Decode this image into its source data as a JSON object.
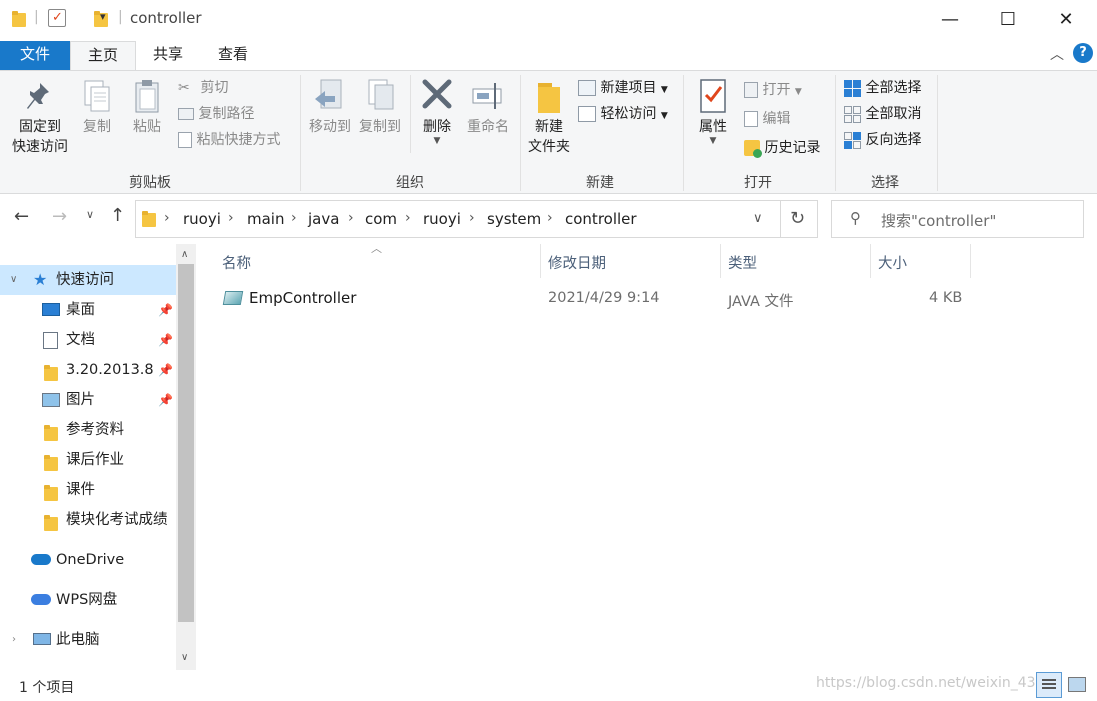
{
  "window": {
    "title": "controller",
    "controls": {
      "minimize": "—",
      "maximize": "☐",
      "close": "✕"
    }
  },
  "tabs": {
    "file": "文件",
    "home": "主页",
    "share": "共享",
    "view": "查看"
  },
  "ribbon": {
    "clipboard": {
      "label": "剪贴板",
      "pin_line1": "固定到",
      "pin_line2": "快速访问",
      "copy": "复制",
      "paste": "粘贴",
      "cut": "剪切",
      "copy_path": "复制路径",
      "paste_shortcut": "粘贴快捷方式"
    },
    "organize": {
      "label": "组织",
      "move_to": "移动到",
      "copy_to": "复制到",
      "delete": "删除",
      "rename": "重命名"
    },
    "new": {
      "label": "新建",
      "new_folder_line1": "新建",
      "new_folder_line2": "文件夹",
      "new_item": "新建项目",
      "easy_access": "轻松访问"
    },
    "open": {
      "label": "打开",
      "properties": "属性",
      "open": "打开",
      "edit": "编辑",
      "history": "历史记录"
    },
    "select": {
      "label": "选择",
      "select_all": "全部选择",
      "select_none": "全部取消",
      "invert": "反向选择"
    }
  },
  "address": {
    "crumbs": [
      "ruoyi",
      "main",
      "java",
      "com",
      "ruoyi",
      "system",
      "controller"
    ]
  },
  "search": {
    "placeholder": "搜索\"controller\""
  },
  "nav": {
    "quick_access": "快速访问",
    "items": [
      {
        "label": "桌面",
        "pinned": true,
        "icon": "desktop-icon"
      },
      {
        "label": "文档",
        "pinned": true,
        "icon": "documents-icon"
      },
      {
        "label": "3.20.2013.8(",
        "pinned": true,
        "icon": "folder-icon"
      },
      {
        "label": "图片",
        "pinned": true,
        "icon": "pictures-icon"
      },
      {
        "label": "参考资料",
        "pinned": false,
        "icon": "folder-icon"
      },
      {
        "label": "课后作业",
        "pinned": false,
        "icon": "folder-icon"
      },
      {
        "label": "课件",
        "pinned": false,
        "icon": "folder-icon"
      },
      {
        "label": "模块化考试成绩",
        "pinned": false,
        "icon": "folder-icon"
      }
    ],
    "onedrive": "OneDrive",
    "wps": "WPS网盘",
    "thispc": "此电脑"
  },
  "columns": {
    "name": "名称",
    "modified": "修改日期",
    "type": "类型",
    "size": "大小"
  },
  "files": [
    {
      "name": "EmpController",
      "modified": "2021/4/29 9:14",
      "type": "JAVA 文件",
      "size": "4 KB"
    }
  ],
  "status": {
    "count": "1 个项目"
  },
  "watermark": "https://blog.csdn.net/weixin_43"
}
